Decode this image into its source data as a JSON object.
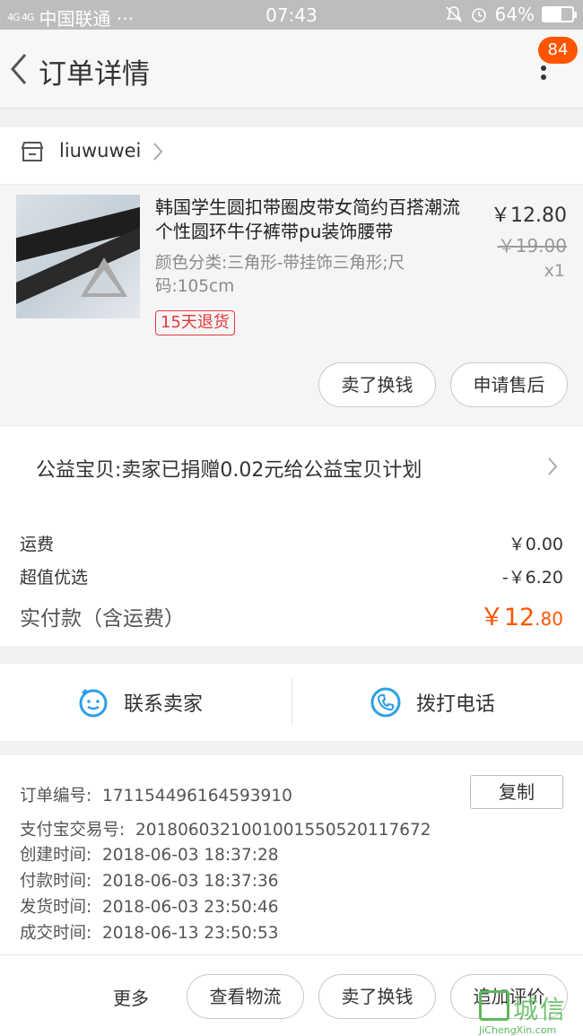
{
  "status_bar": {
    "signal": "4G 4G",
    "carrier": "中国联通 ···",
    "time": "07:43",
    "battery": "64%",
    "battery_level": 0.64
  },
  "header": {
    "title": "订单详情",
    "badge_count": "84"
  },
  "shop": {
    "name": "liuwuwei"
  },
  "product": {
    "title": "韩国学生圆扣带圈皮带女简约百搭潮流个性圆环牛仔裤带pu装饰腰带",
    "sku": "颜色分类:三角形-带挂饰三角形;尺码:105cm",
    "return_tag": "15天退货",
    "price_now": "￥12.80",
    "price_old": "￥19.00",
    "qty": "x1",
    "btn_resell": "卖了换钱",
    "btn_aftersale": "申请售后"
  },
  "charity": {
    "text": "公益宝贝:卖家已捐赠0.02元给公益宝贝计划"
  },
  "fees": {
    "shipping_label": "运费",
    "shipping_value": "￥0.00",
    "discount_label": "超值优选",
    "discount_value": "-￥6.20",
    "total_label": "实付款（含运费）",
    "total_main": "￥12",
    "total_cents": ".80"
  },
  "contact": {
    "seller": "联系卖家",
    "call": "拨打电话"
  },
  "order_info": {
    "order_no_label": "订单编号:",
    "order_no": "171154496164593910",
    "copy": "复制",
    "alipay_label": "支付宝交易号:",
    "alipay_no": "2018060321001001550520117672",
    "created_label": "创建时间:",
    "created": "2018-06-03 18:37:28",
    "paid_label": "付款时间:",
    "paid": "2018-06-03 18:37:36",
    "shipped_label": "发货时间:",
    "shipped": "2018-06-03 23:50:46",
    "done_label": "成交时间:",
    "done": "2018-06-13 23:50:53"
  },
  "bottom_bar": {
    "more": "更多",
    "logistics": "查看物流",
    "resell": "卖了换钱",
    "review": "追加评价"
  },
  "watermark": {
    "cn": "城信",
    "en": "JiChengXin.com"
  },
  "colors": {
    "accent": "#ff5500",
    "link_blue": "#2f9fe8",
    "tag_red": "#e4393c"
  }
}
